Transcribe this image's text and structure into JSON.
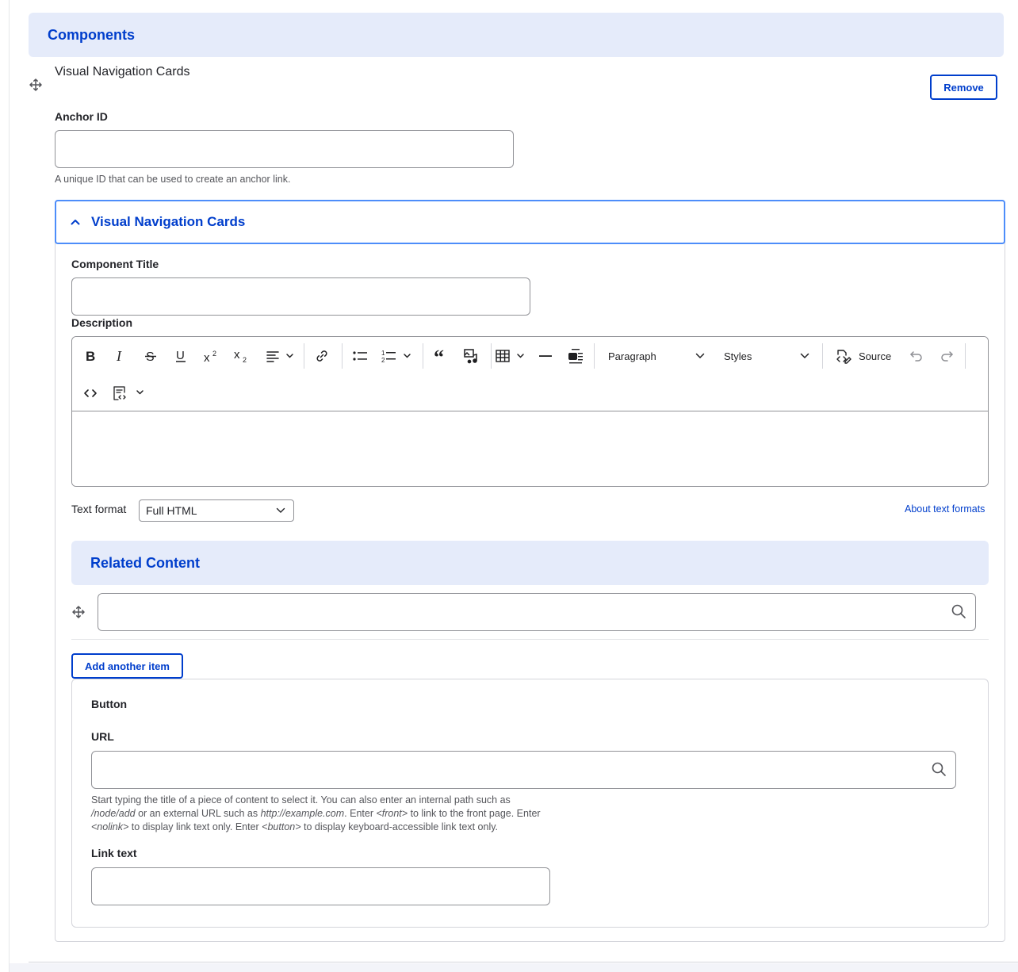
{
  "components_section": {
    "title": "Components"
  },
  "paragraph": {
    "title": "Visual Navigation Cards",
    "remove_label": "Remove",
    "anchor": {
      "label": "Anchor ID",
      "value": "",
      "description": "A unique ID that can be used to create an anchor link."
    },
    "details": {
      "summary": "Visual Navigation Cards",
      "component_title": {
        "label": "Component Title",
        "value": ""
      },
      "description_field": {
        "label": "Description",
        "toolbar": {
          "paragraph_dropdown": "Paragraph",
          "styles_dropdown": "Styles",
          "source_label": "Source",
          "icons": [
            "bold-icon",
            "italic-icon",
            "strikethrough-icon",
            "underline-icon",
            "superscript-icon",
            "subscript-icon",
            "align-icon",
            "link-icon",
            "bulleted-list-icon",
            "numbered-list-icon",
            "blockquote-icon",
            "media-icon",
            "table-icon",
            "horizontal-line-icon",
            "drupal-media-icon",
            "source-icon",
            "undo-icon",
            "redo-icon",
            "code-icon",
            "code-block-icon"
          ]
        },
        "text_format_label": "Text format",
        "text_format_value": "Full HTML",
        "about_link": "About text formats"
      },
      "related_content": {
        "title": "Related Content",
        "add_another_label": "Add another item"
      },
      "button_group": {
        "legend": "Button",
        "url": {
          "label": "URL",
          "help_1": "Start typing the title of a piece of content to select it. You can also enter an internal path such as",
          "help_2a": "/node/add",
          "help_2b": " or an external URL such as ",
          "help_2c": "http://example.com",
          "help_2d": ". Enter ",
          "help_2e": "<front>",
          "help_2f": " to link to the front page. Enter",
          "help_3a": "<nolink>",
          "help_3b": " to display link text only. Enter ",
          "help_3c": "<button>",
          "help_3d": " to display keyboard-accessible link text only."
        },
        "link_text": {
          "label": "Link text"
        }
      }
    }
  },
  "colors": {
    "accent": "#003ecc",
    "header_bg": "#e5ebfa",
    "focus_border": "#4d8dfa"
  }
}
